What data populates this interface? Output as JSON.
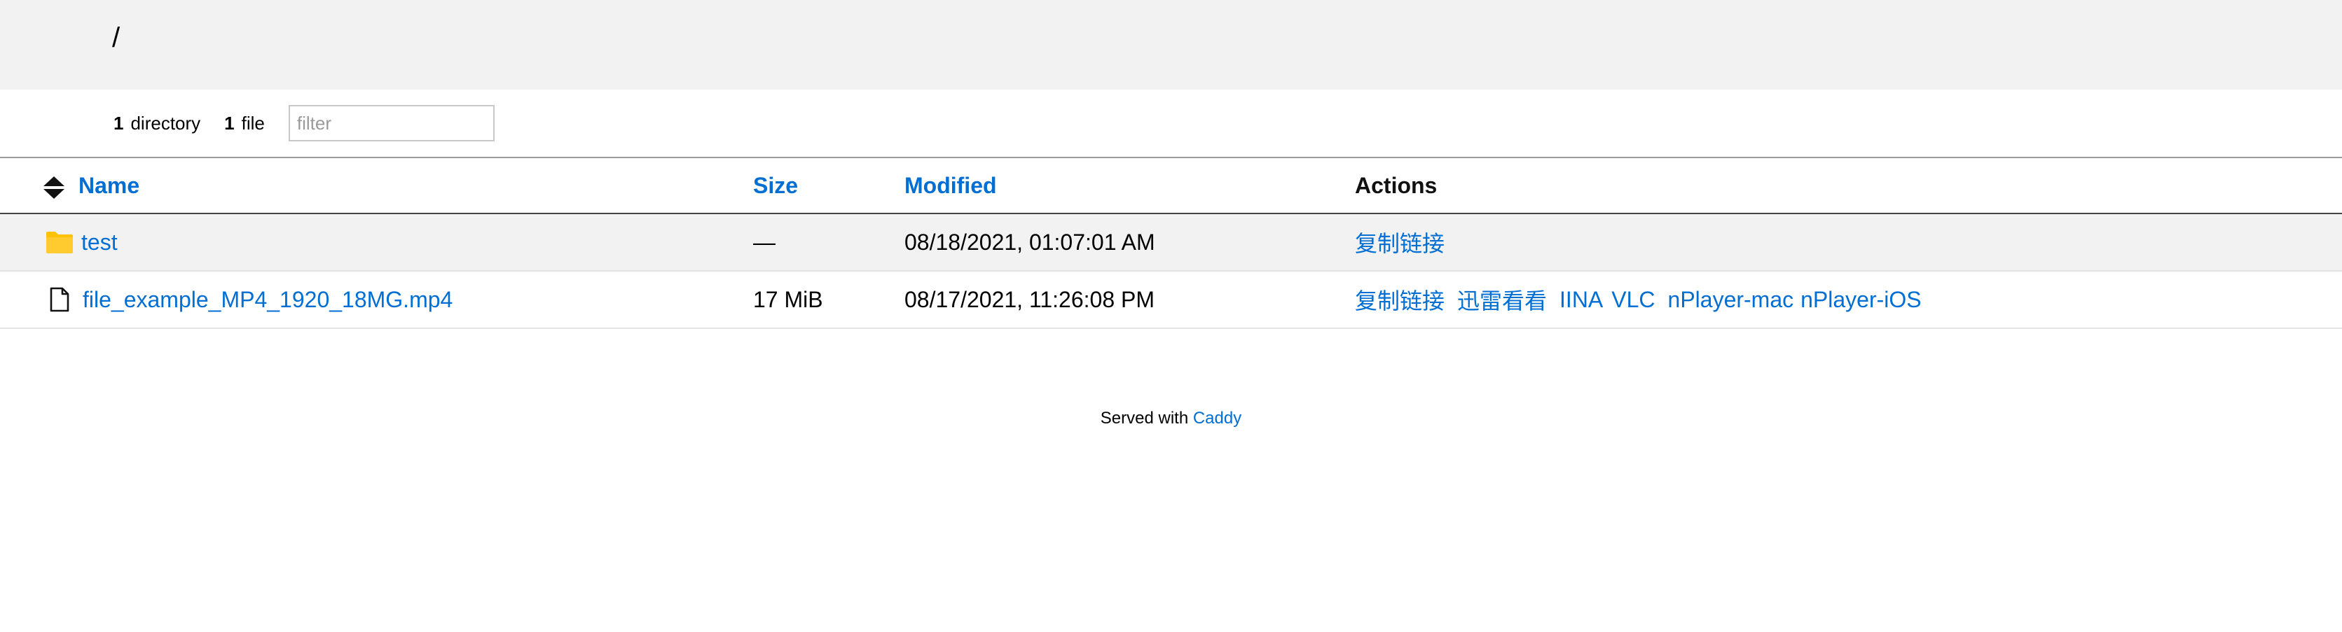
{
  "breadcrumb": {
    "path": "/"
  },
  "summary": {
    "dir_count": "1",
    "dir_label": "directory",
    "file_count": "1",
    "file_label": "file",
    "filter_placeholder": "filter"
  },
  "table": {
    "headers": {
      "name": "Name",
      "size": "Size",
      "modified": "Modified",
      "actions": "Actions"
    },
    "rows": [
      {
        "type": "folder",
        "icon": "folder-icon",
        "name": "test",
        "size": "—",
        "modified": "08/18/2021, 01:07:01 AM",
        "actions": [
          "复制链接"
        ]
      },
      {
        "type": "file",
        "icon": "file-icon",
        "name": "file_example_MP4_1920_18MG.mp4",
        "size": "17 MiB",
        "modified": "08/17/2021, 11:26:08 PM",
        "actions": [
          "复制链接",
          "迅雷看看",
          "IINA",
          "VLC",
          "nPlayer-mac",
          "nPlayer-iOS"
        ]
      }
    ]
  },
  "footer": {
    "text": "Served with",
    "link": "Caddy"
  },
  "colors": {
    "link": "#006ed3",
    "header_bg": "#f2f2f2",
    "folder": "#ffc107"
  }
}
